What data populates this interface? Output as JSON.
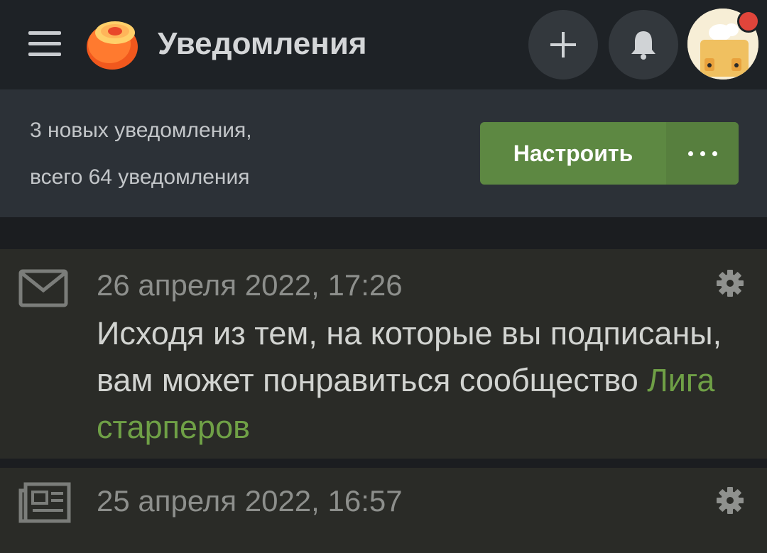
{
  "header": {
    "title": "Уведомления",
    "add_icon": "plus-icon",
    "bell_icon": "bell-icon",
    "menu_icon": "hamburger-menu-icon",
    "logo_icon": "pikabu-logo-icon",
    "avatar_icon": "user-avatar",
    "has_unread_dot": true
  },
  "summary": {
    "line1": "3 новых уведомления,",
    "line2": "всего 64 уведомления",
    "settings_button": "Настроить",
    "more_icon": "more-dots-icon"
  },
  "notifications": [
    {
      "icon": "envelope-icon",
      "date": "26 апреля 2022, 17:26",
      "text": "Исходя из тем, на которые вы подписаны, вам может понравиться сообщество ",
      "link": "Лига старперов",
      "settings_icon": "gear-icon"
    },
    {
      "icon": "newspaper-icon",
      "date": "25 апреля 2022, 16:57",
      "settings_icon": "gear-icon"
    }
  ],
  "colors": {
    "topbar": "#1e2226",
    "summary_bg": "#2c3137",
    "button_green": "#5d8842",
    "link_green": "#6fa046",
    "notification_bg": "#2a2b27"
  }
}
